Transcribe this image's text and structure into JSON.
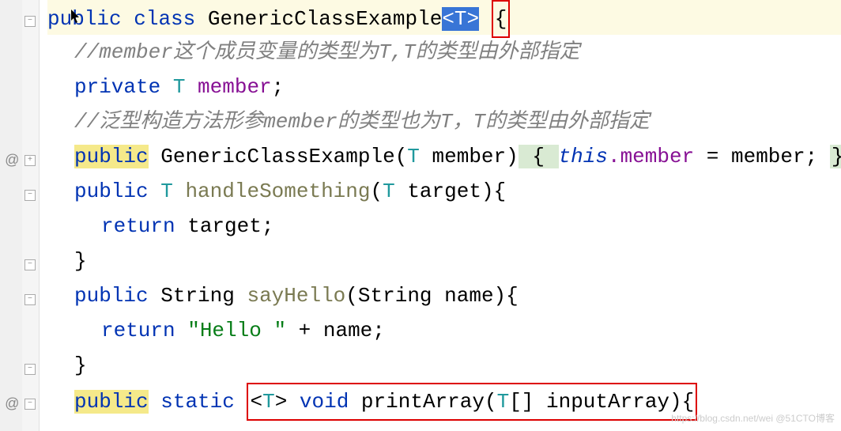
{
  "gutter": {
    "override_symbol": "@"
  },
  "lines": {
    "l1": {
      "kw_public": "public",
      "kw_class": "class",
      "class_name": "GenericClassExample",
      "type_param": "<T>",
      "brace": "{"
    },
    "l2": {
      "comment": "//member这个成员变量的类型为T,T的类型由外部指定"
    },
    "l3": {
      "kw_private": "private",
      "type": "T",
      "name": "member",
      "semi": ";"
    },
    "l4": {
      "comment": "//泛型构造方法形参member的类型也为T，T的类型由外部指定"
    },
    "l5": {
      "kw_public": "public",
      "ctor": "GenericClassExample",
      "lp": "(",
      "ptype": "T",
      "pname": " member",
      "rp": ")",
      "lbrace": " { ",
      "this": "this",
      "dot_field": ".member",
      "eq": " = ",
      "rhs": "member; ",
      "rbrace": "}"
    },
    "l6": {
      "kw_public": "public",
      "ret": "T",
      "name": "handleSomething",
      "lp": "(",
      "ptype": "T",
      "pname": " target",
      "rp_brace": "){"
    },
    "l7": {
      "kw_return": "return",
      "expr": " target;"
    },
    "l8": {
      "brace": "}"
    },
    "l9": {
      "kw_public": "public",
      "ret": "String",
      "name": "sayHello",
      "lp": "(",
      "ptype": "String",
      "pname": " name",
      "rp_brace": "){"
    },
    "l10": {
      "kw_return": "return",
      "str": " \"Hello \"",
      "plus": " + name;"
    },
    "l11": {
      "brace": "}"
    },
    "l12": {
      "kw_public": "public",
      "kw_static": "static",
      "tp_open": " <",
      "tp": "T",
      "tp_close": "> ",
      "kw_void": "void",
      "name": " printArray",
      "lp": "(",
      "ptype": "T",
      "arr": "[] inputArray",
      "rp_brace": "){"
    }
  },
  "watermark": "https://blog.csdn.net/wei @51CTO博客"
}
